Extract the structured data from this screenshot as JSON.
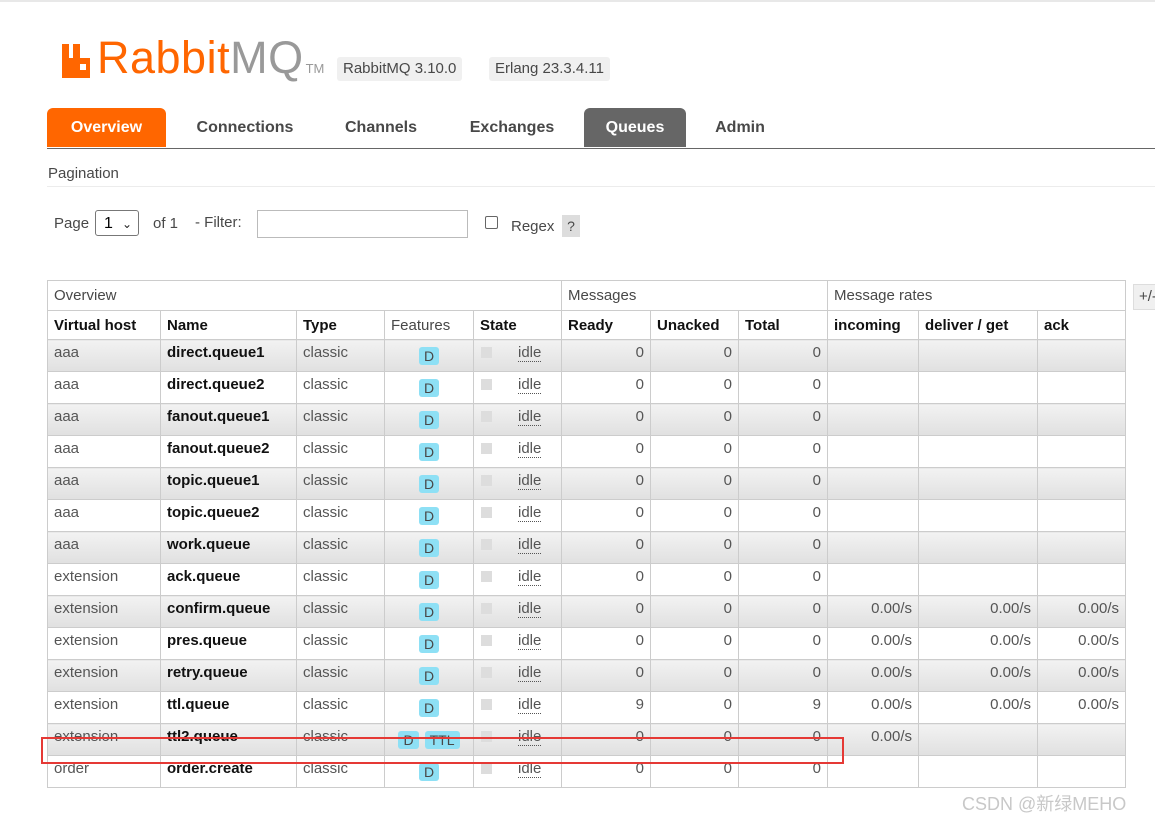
{
  "brand": {
    "name_part1": "Rabbit",
    "name_part2": "MQ",
    "tm": "TM",
    "color": "#ff6600"
  },
  "versions": {
    "rabbitmq": "RabbitMQ 3.10.0",
    "erlang": "Erlang 23.3.4.11"
  },
  "nav": {
    "tabs": [
      {
        "label": "Overview",
        "state": "active-orange"
      },
      {
        "label": "Connections",
        "state": ""
      },
      {
        "label": "Channels",
        "state": ""
      },
      {
        "label": "Exchanges",
        "state": ""
      },
      {
        "label": "Queues",
        "state": "active-grey"
      },
      {
        "label": "Admin",
        "state": ""
      }
    ]
  },
  "pagination": {
    "section_title": "Pagination",
    "page_label": "Page",
    "page_value": "1",
    "of_label": "of 1",
    "filter_label": "- Filter:",
    "filter_value": "",
    "regex_label": "Regex",
    "help_label": "?"
  },
  "table": {
    "groups": [
      "Overview",
      "Messages",
      "Message rates"
    ],
    "columns": [
      "Virtual host",
      "Name",
      "Type",
      "Features",
      "State",
      "Ready",
      "Unacked",
      "Total",
      "incoming",
      "deliver / get",
      "ack"
    ],
    "plus_minus": "+/-",
    "rows": [
      {
        "vhost": "aaa",
        "name": "direct.queue1",
        "type": "classic",
        "features": [
          "D"
        ],
        "state": "idle",
        "ready": "0",
        "unacked": "0",
        "total": "0",
        "incoming": "",
        "deliver": "",
        "ack": ""
      },
      {
        "vhost": "aaa",
        "name": "direct.queue2",
        "type": "classic",
        "features": [
          "D"
        ],
        "state": "idle",
        "ready": "0",
        "unacked": "0",
        "total": "0",
        "incoming": "",
        "deliver": "",
        "ack": ""
      },
      {
        "vhost": "aaa",
        "name": "fanout.queue1",
        "type": "classic",
        "features": [
          "D"
        ],
        "state": "idle",
        "ready": "0",
        "unacked": "0",
        "total": "0",
        "incoming": "",
        "deliver": "",
        "ack": ""
      },
      {
        "vhost": "aaa",
        "name": "fanout.queue2",
        "type": "classic",
        "features": [
          "D"
        ],
        "state": "idle",
        "ready": "0",
        "unacked": "0",
        "total": "0",
        "incoming": "",
        "deliver": "",
        "ack": ""
      },
      {
        "vhost": "aaa",
        "name": "topic.queue1",
        "type": "classic",
        "features": [
          "D"
        ],
        "state": "idle",
        "ready": "0",
        "unacked": "0",
        "total": "0",
        "incoming": "",
        "deliver": "",
        "ack": ""
      },
      {
        "vhost": "aaa",
        "name": "topic.queue2",
        "type": "classic",
        "features": [
          "D"
        ],
        "state": "idle",
        "ready": "0",
        "unacked": "0",
        "total": "0",
        "incoming": "",
        "deliver": "",
        "ack": ""
      },
      {
        "vhost": "aaa",
        "name": "work.queue",
        "type": "classic",
        "features": [
          "D"
        ],
        "state": "idle",
        "ready": "0",
        "unacked": "0",
        "total": "0",
        "incoming": "",
        "deliver": "",
        "ack": ""
      },
      {
        "vhost": "extension",
        "name": "ack.queue",
        "type": "classic",
        "features": [
          "D"
        ],
        "state": "idle",
        "ready": "0",
        "unacked": "0",
        "total": "0",
        "incoming": "",
        "deliver": "",
        "ack": ""
      },
      {
        "vhost": "extension",
        "name": "confirm.queue",
        "type": "classic",
        "features": [
          "D"
        ],
        "state": "idle",
        "ready": "0",
        "unacked": "0",
        "total": "0",
        "incoming": "0.00/s",
        "deliver": "0.00/s",
        "ack": "0.00/s"
      },
      {
        "vhost": "extension",
        "name": "pres.queue",
        "type": "classic",
        "features": [
          "D"
        ],
        "state": "idle",
        "ready": "0",
        "unacked": "0",
        "total": "0",
        "incoming": "0.00/s",
        "deliver": "0.00/s",
        "ack": "0.00/s"
      },
      {
        "vhost": "extension",
        "name": "retry.queue",
        "type": "classic",
        "features": [
          "D"
        ],
        "state": "idle",
        "ready": "0",
        "unacked": "0",
        "total": "0",
        "incoming": "0.00/s",
        "deliver": "0.00/s",
        "ack": "0.00/s"
      },
      {
        "vhost": "extension",
        "name": "ttl.queue",
        "type": "classic",
        "features": [
          "D"
        ],
        "state": "idle",
        "ready": "9",
        "unacked": "0",
        "total": "9",
        "incoming": "0.00/s",
        "deliver": "0.00/s",
        "ack": "0.00/s"
      },
      {
        "vhost": "extension",
        "name": "ttl2.queue",
        "type": "classic",
        "features": [
          "D",
          "TTL"
        ],
        "state": "idle",
        "ready": "0",
        "unacked": "0",
        "total": "0",
        "incoming": "0.00/s",
        "deliver": "",
        "ack": ""
      },
      {
        "vhost": "order",
        "name": "order.create",
        "type": "classic",
        "features": [
          "D"
        ],
        "state": "idle",
        "ready": "0",
        "unacked": "0",
        "total": "0",
        "incoming": "",
        "deliver": "",
        "ack": ""
      }
    ]
  },
  "colors": {
    "highlight": "#e53935",
    "feature_badge": "#8ee0f5",
    "active_tab_grey": "#666666"
  },
  "watermark": "CSDN @新绿MEHO"
}
